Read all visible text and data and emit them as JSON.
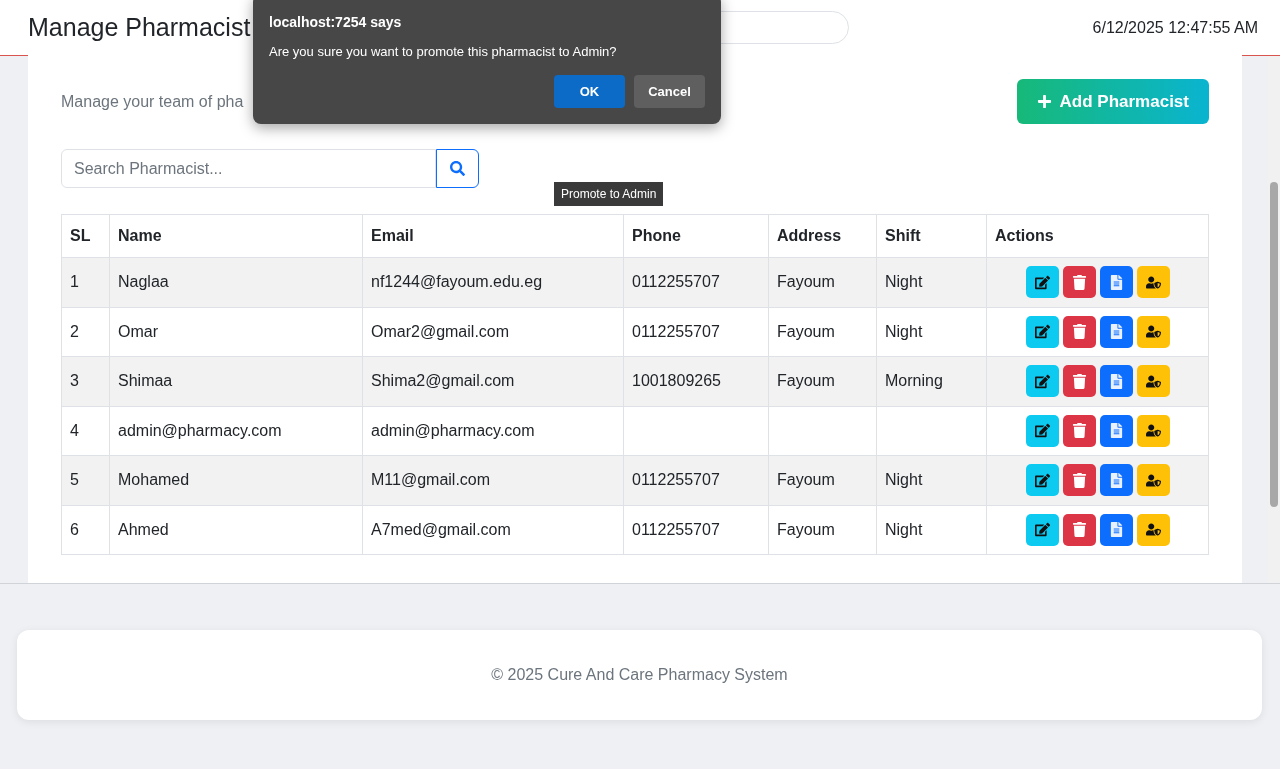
{
  "header": {
    "title": "Manage Pharmacist",
    "datetime": "6/12/2025 12:47:55 AM"
  },
  "page": {
    "subtitle": "Manage your team of pha",
    "add_button": "Add Pharmacist",
    "search": {
      "placeholder": "Search Pharmacist..."
    }
  },
  "tooltip": "Promote to Admin",
  "table": {
    "columns": [
      "SL",
      "Name",
      "Email",
      "Phone",
      "Address",
      "Shift",
      "Actions"
    ],
    "rows": [
      {
        "sl": "1",
        "name": "Naglaa",
        "email": "nf1244@fayoum.edu.eg",
        "phone": "0112255707",
        "address": "Fayoum",
        "shift": "Night"
      },
      {
        "sl": "2",
        "name": "Omar",
        "email": "Omar2@gmail.com",
        "phone": "0112255707",
        "address": "Fayoum",
        "shift": "Night"
      },
      {
        "sl": "3",
        "name": "Shimaa",
        "email": "Shima2@gmail.com",
        "phone": "1001809265",
        "address": "Fayoum",
        "shift": "Morning"
      },
      {
        "sl": "4",
        "name": "admin@pharmacy.com",
        "email": "admin@pharmacy.com"
      },
      {
        "sl": "5",
        "name": "Mohamed",
        "email": "M11@gmail.com",
        "phone": "0112255707",
        "address": "Fayoum",
        "shift": "Night"
      },
      {
        "sl": "6",
        "name": "Ahmed",
        "email": "A7med@gmail.com",
        "phone": "0112255707",
        "address": "Fayoum",
        "shift": "Night"
      }
    ]
  },
  "footer": "© 2025 Cure And Care Pharmacy System",
  "dialog": {
    "title": "localhost:7254 says",
    "message": "Are you sure you want to promote this pharmacist to Admin?",
    "buttons": [
      {
        "label": "OK",
        "kind": "primary"
      },
      {
        "label": "Cancel",
        "kind": "secondary"
      }
    ]
  }
}
